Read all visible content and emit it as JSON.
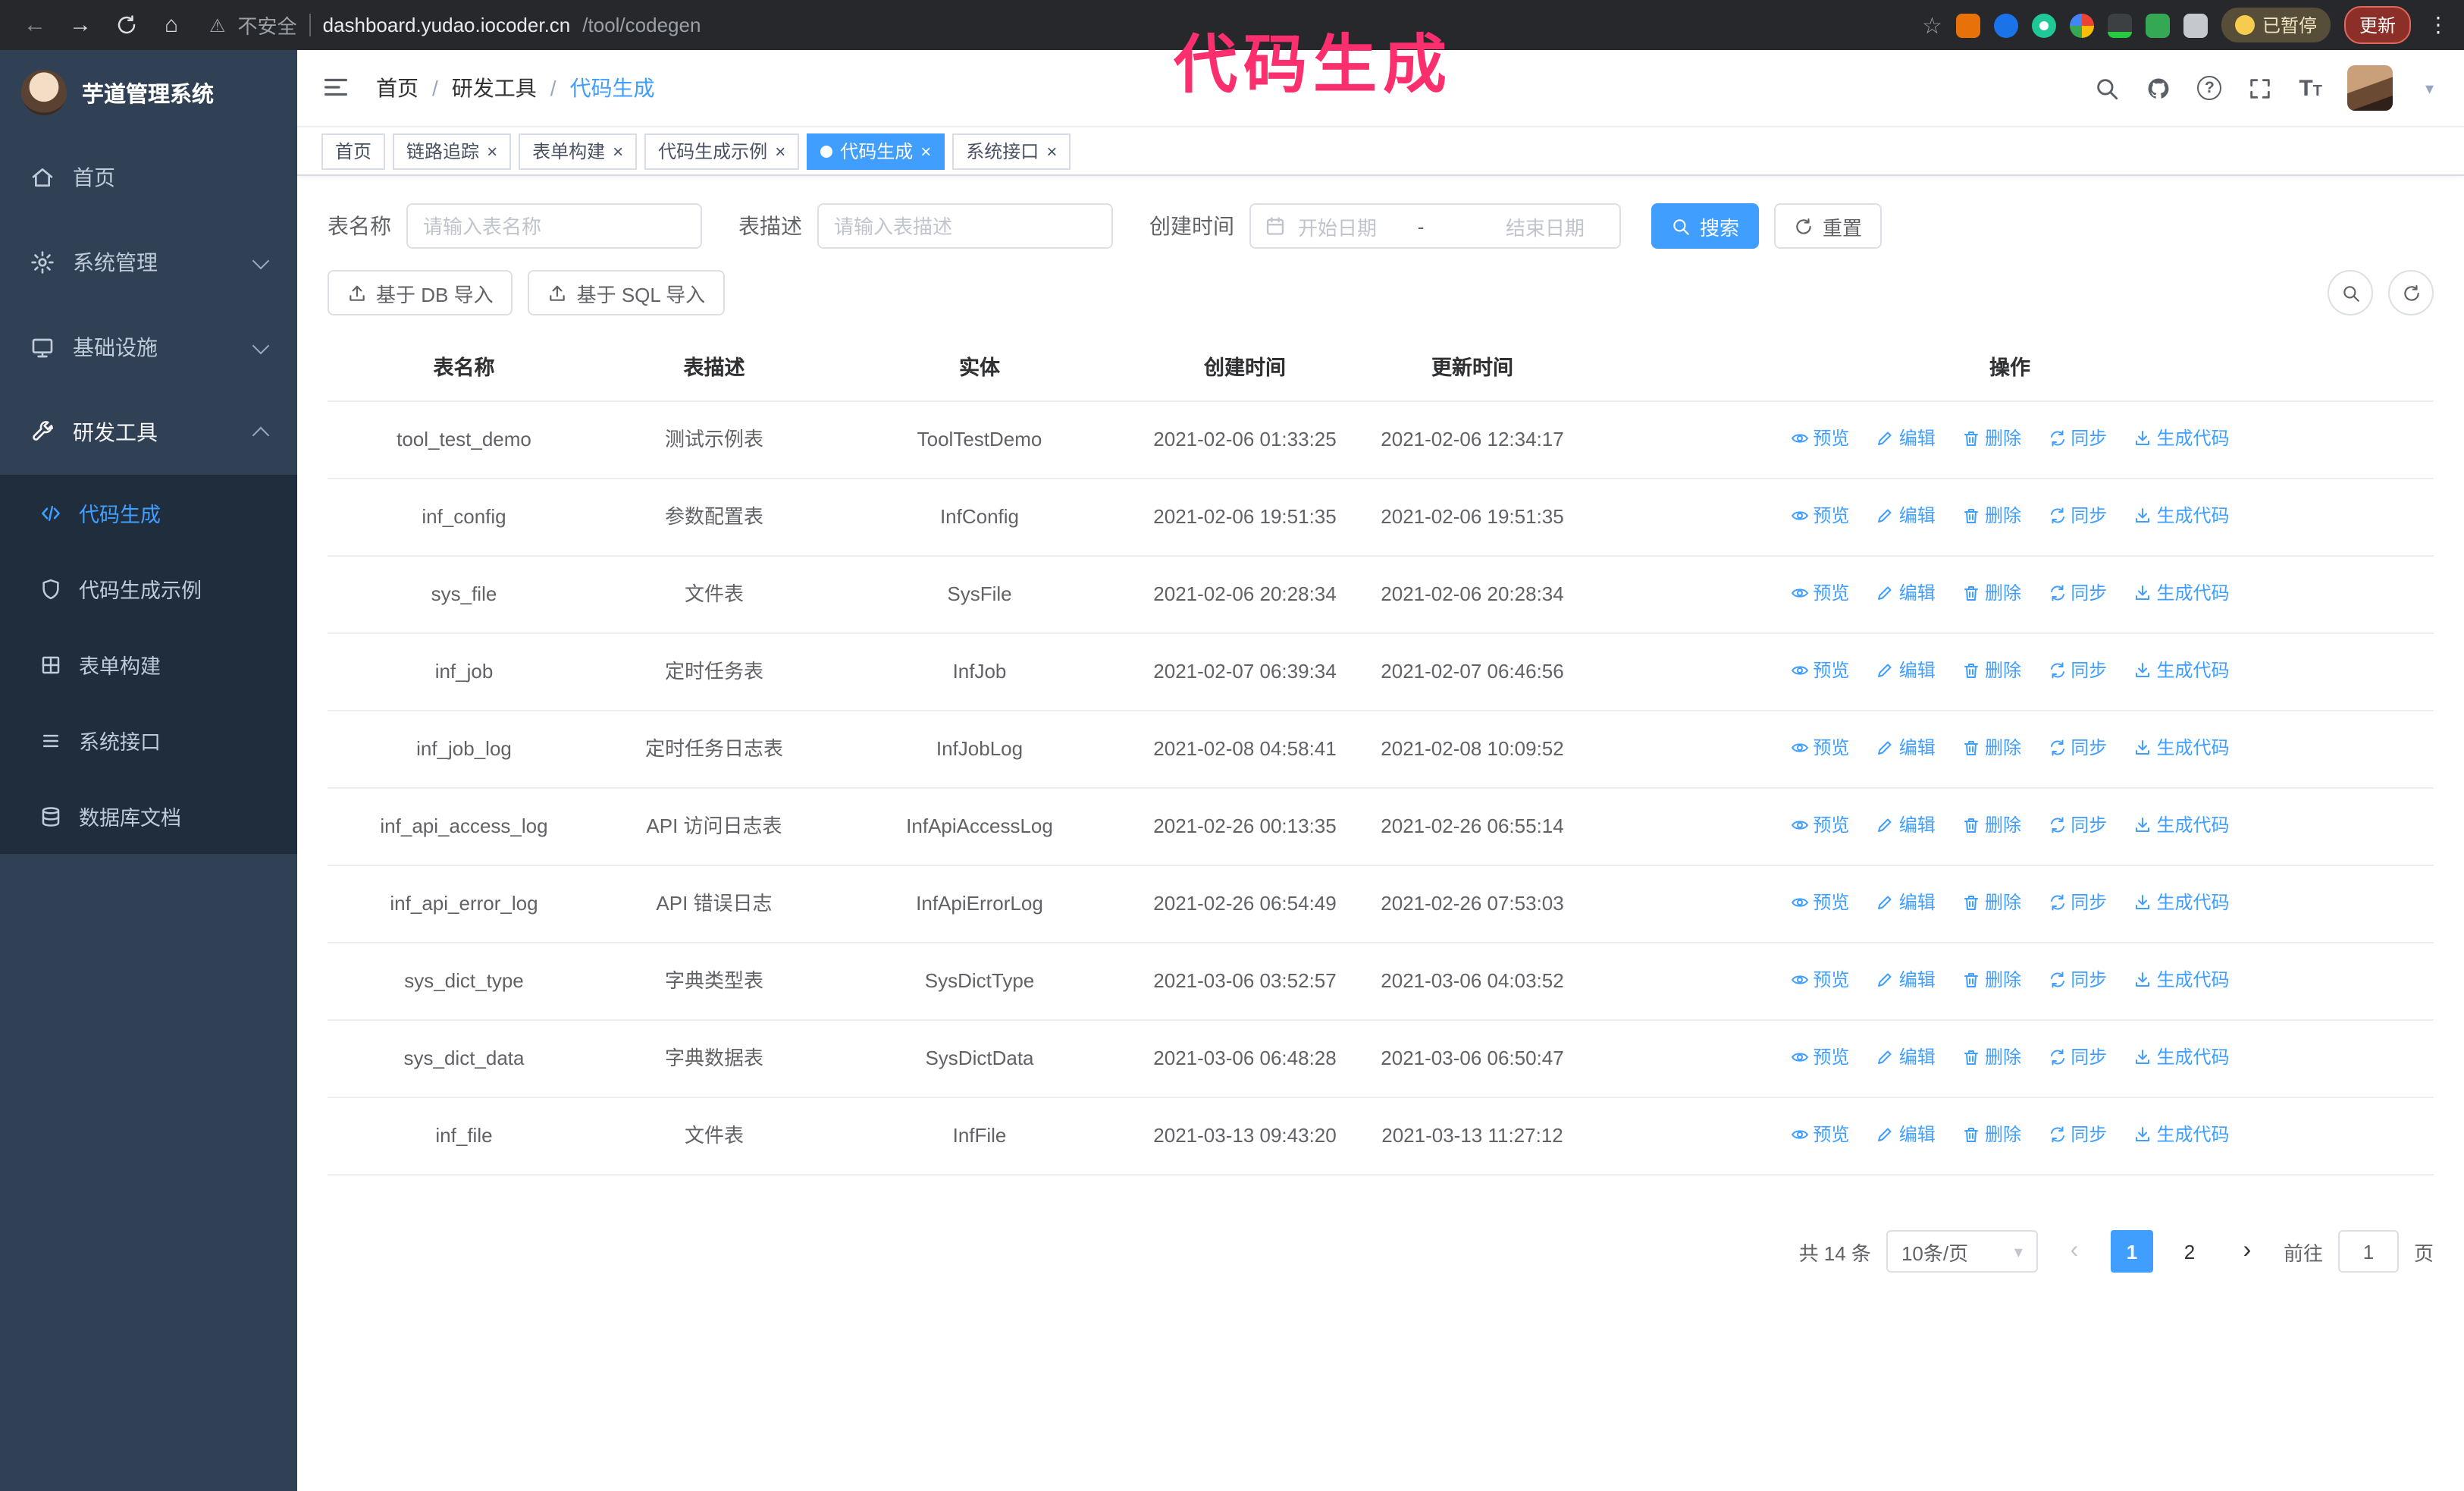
{
  "annotation": {
    "text": "代码生成"
  },
  "icons": {
    "back": "←",
    "forward": "→",
    "home": "⌂",
    "warning": "⚠",
    "star": "☆",
    "more_vertical": "⋮",
    "caret_down": "▾",
    "close": "×",
    "question": "?",
    "prev": "‹",
    "next": "›",
    "font_big": "T",
    "font_small": "T"
  },
  "browser": {
    "security_text": "不安全",
    "url_domain": "dashboard.yudao.iocoder.cn",
    "url_path": "/tool/codegen",
    "paused_badge": "已暂停",
    "update_button": "更新"
  },
  "sidebar": {
    "title": "芋道管理系统",
    "menu": [
      {
        "label": "首页"
      },
      {
        "label": "系统管理"
      },
      {
        "label": "基础设施"
      },
      {
        "label": "研发工具"
      }
    ],
    "submenu": [
      {
        "label": "代码生成"
      },
      {
        "label": "代码生成示例"
      },
      {
        "label": "表单构建"
      },
      {
        "label": "系统接口"
      },
      {
        "label": "数据库文档"
      }
    ]
  },
  "breadcrumb": {
    "items": [
      "首页",
      "研发工具",
      "代码生成"
    ],
    "separator": "/"
  },
  "tabs": [
    {
      "label": "首页"
    },
    {
      "label": "链路追踪"
    },
    {
      "label": "表单构建"
    },
    {
      "label": "代码生成示例"
    },
    {
      "label": "代码生成"
    },
    {
      "label": "系统接口"
    }
  ],
  "filters": {
    "table_name_label": "表名称",
    "table_name_placeholder": "请输入表名称",
    "table_desc_label": "表描述",
    "table_desc_placeholder": "请输入表描述",
    "create_time_label": "创建时间",
    "date_start_placeholder": "开始日期",
    "date_separator": "-",
    "date_end_placeholder": "结束日期",
    "search_label": "搜索",
    "reset_label": "重置"
  },
  "toolbar": {
    "import_db_label": "基于 DB 导入",
    "import_sql_label": "基于 SQL 导入"
  },
  "table": {
    "columns": [
      "表名称",
      "表描述",
      "实体",
      "创建时间",
      "更新时间",
      "操作"
    ],
    "action_labels": [
      "预览",
      "编辑",
      "删除",
      "同步",
      "生成代码"
    ],
    "rows": [
      {
        "name": "tool_test_demo",
        "desc": "测试示例表",
        "entity": "ToolTestDemo",
        "created": "2021-02-06 01:33:25",
        "updated": "2021-02-06 12:34:17"
      },
      {
        "name": "inf_config",
        "desc": "参数配置表",
        "entity": "InfConfig",
        "created": "2021-02-06 19:51:35",
        "updated": "2021-02-06 19:51:35"
      },
      {
        "name": "sys_file",
        "desc": "文件表",
        "entity": "SysFile",
        "created": "2021-02-06 20:28:34",
        "updated": "2021-02-06 20:28:34"
      },
      {
        "name": "inf_job",
        "desc": "定时任务表",
        "entity": "InfJob",
        "created": "2021-02-07 06:39:34",
        "updated": "2021-02-07 06:46:56"
      },
      {
        "name": "inf_job_log",
        "desc": "定时任务日志表",
        "entity": "InfJobLog",
        "created": "2021-02-08 04:58:41",
        "updated": "2021-02-08 10:09:52"
      },
      {
        "name": "inf_api_access_log",
        "desc": "API 访问日志表",
        "entity": "InfApiAccessLog",
        "created": "2021-02-26 00:13:35",
        "updated": "2021-02-26 06:55:14"
      },
      {
        "name": "inf_api_error_log",
        "desc": "API 错误日志",
        "entity": "InfApiErrorLog",
        "created": "2021-02-26 06:54:49",
        "updated": "2021-02-26 07:53:03"
      },
      {
        "name": "sys_dict_type",
        "desc": "字典类型表",
        "entity": "SysDictType",
        "created": "2021-03-06 03:52:57",
        "updated": "2021-03-06 04:03:52"
      },
      {
        "name": "sys_dict_data",
        "desc": "字典数据表",
        "entity": "SysDictData",
        "created": "2021-03-06 06:48:28",
        "updated": "2021-03-06 06:50:47"
      },
      {
        "name": "inf_file",
        "desc": "文件表",
        "entity": "InfFile",
        "created": "2021-03-13 09:43:20",
        "updated": "2021-03-13 11:27:12"
      }
    ]
  },
  "pagination": {
    "total_text": "共 14 条",
    "page_size_text": "10条/页",
    "page_1": "1",
    "page_2": "2",
    "goto_label": "前往",
    "goto_value": "1",
    "goto_unit": "页"
  },
  "colors": {
    "primary": "#409eff",
    "sidebar_bg": "#304156",
    "submenu_bg": "#1f2d3d",
    "annotation": "#fb2e6e"
  }
}
